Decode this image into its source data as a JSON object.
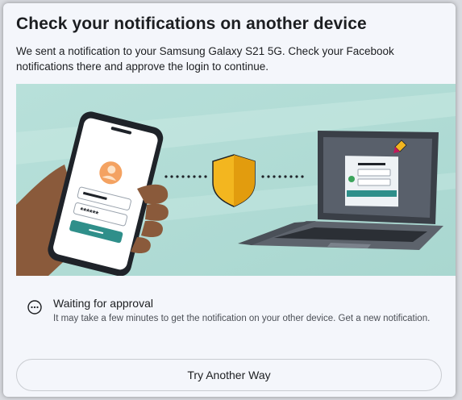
{
  "dialog": {
    "title": "Check your notifications on another device",
    "description": "We sent a notification to your Samsung Galaxy S21 5G. Check your Facebook notifications there and approve the login to continue."
  },
  "illustration": {
    "password_mask": "******",
    "icons": [
      "phone",
      "shield-icon",
      "laptop",
      "check-icon",
      "pencil-icon"
    ],
    "colors": {
      "background": "#bfe3dd",
      "shield": "#f3b61f",
      "accent": "#2f8f8a",
      "skin": "#8a5a3b"
    }
  },
  "status": {
    "icon": "more-dots-icon",
    "title": "Waiting for approval",
    "text": "It may take a few minutes to get the notification on your other device. Get a new notification."
  },
  "actions": {
    "try_another_way": "Try Another Way"
  }
}
